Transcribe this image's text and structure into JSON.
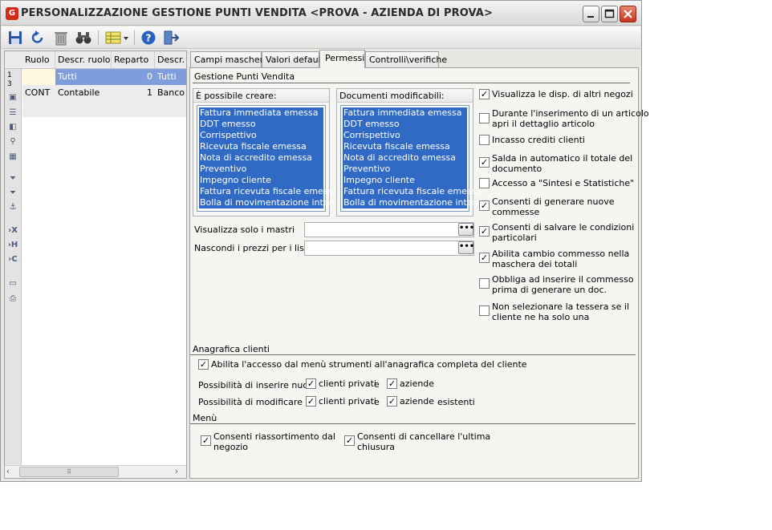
{
  "window": {
    "title": "PERSONALIZZAZIONE GESTIONE PUNTI VENDITA <PROVA - AZIENDA DI PROVA>",
    "app_icon": "G"
  },
  "toolbar": {
    "icons": [
      "save-icon",
      "undo-icon",
      "delete-icon",
      "find-icon",
      "grid-options-icon",
      "help-icon",
      "exit-icon"
    ]
  },
  "grid": {
    "columns": [
      "Ruolo",
      "Descr. ruolo",
      "Reparto",
      "Descr."
    ],
    "rows": [
      {
        "ruolo": "",
        "descr_ruolo": "Tutti",
        "reparto": "0",
        "descr": "Tutti"
      },
      {
        "ruolo": "CONT",
        "descr_ruolo": "Contabile",
        "reparto": "1",
        "descr": "Banco F"
      }
    ],
    "row_numbers": [
      "1",
      "3"
    ],
    "scroll_handle": "⠿"
  },
  "tabs": {
    "items": [
      "Campi maschera",
      "Valori default",
      "Permessi",
      "Controlli\\verifiche"
    ],
    "active": "Permessi"
  },
  "gestione": {
    "title": "Gestione Punti Vendita",
    "possibile_creare": {
      "title": "È possibile creare:",
      "items": [
        "Fattura immediata emessa",
        "DDT emesso",
        "Corrispettivo",
        "Ricevuta fiscale emessa",
        "Nota di accredito emessa",
        "Preventivo",
        "Impegno cliente",
        "Fattura ricevuta fiscale emessa",
        "Bolla di movimentazione interna"
      ]
    },
    "documenti_modificabili": {
      "title": "Documenti modificabili:",
      "items": [
        "Fattura immediata emessa",
        "DDT emesso",
        "Corrispettivo",
        "Ricevuta fiscale emessa",
        "Nota di accredito emessa",
        "Preventivo",
        "Impegno cliente",
        "Fattura ricevuta fiscale emessa",
        "Bolla di movimentazione interna"
      ]
    },
    "fields": {
      "visualizza_mastri": {
        "label": "Visualizza solo i mastri",
        "value": ""
      },
      "nascondi_prezzi": {
        "label": "Nascondi i prezzi per i listini",
        "value": ""
      },
      "ellipsis": "•••"
    },
    "checks": [
      {
        "line1": "Visualizza le disp. di altri negozi",
        "line2": "",
        "checked": true
      },
      {
        "line1": "Durante l'inserimento di un articolo",
        "line2": "apri il dettaglio articolo",
        "checked": false
      },
      {
        "line1": "Incasso crediti clienti",
        "line2": "",
        "checked": false
      },
      {
        "line1": "Salda in automatico il totale del",
        "line2": "documento",
        "checked": true
      },
      {
        "line1": "Accesso a \"Sintesi e Statistiche\"",
        "line2": "",
        "checked": false
      },
      {
        "line1": "Consenti di generare nuove",
        "line2": "commesse",
        "checked": true
      },
      {
        "line1": "Consenti di salvare le condizioni",
        "line2": "particolari",
        "checked": true
      },
      {
        "line1": "Abilita cambio commesso nella",
        "line2": "maschera dei totali",
        "checked": true
      },
      {
        "line1": "Obbliga ad inserire il commesso",
        "line2": "prima di generare un doc.",
        "checked": false
      },
      {
        "line1": "Non selezionare la tessera se il",
        "line2": "cliente ne ha solo una",
        "checked": false
      }
    ]
  },
  "anagrafica": {
    "title": "Anagrafica clienti",
    "abilita_accesso": {
      "label": "Abilita l'accesso dal menù strumenti all'anagrafica completa del cliente",
      "checked": true
    },
    "inserire": {
      "label": "Possibilità di inserire nuovi",
      "privati": "clienti privati",
      "e": "e",
      "aziende": "aziende",
      "suffix": ""
    },
    "modificare": {
      "label": "Possibilità di modificare",
      "privati": "clienti privati",
      "e": "e",
      "aziende": "aziende",
      "suffix": "esistenti"
    }
  },
  "menu": {
    "title": "Menù",
    "riassortimento": {
      "line1": "Consenti riassortimento dal",
      "line2": "negozio",
      "checked": true
    },
    "cancellare": {
      "line1": "Consenti di cancellare l'ultima",
      "line2": "chiusura",
      "checked": true
    }
  },
  "check_glyph": "✓",
  "colors": {
    "selection": "#316ac5",
    "close_button": "#c9341d"
  }
}
